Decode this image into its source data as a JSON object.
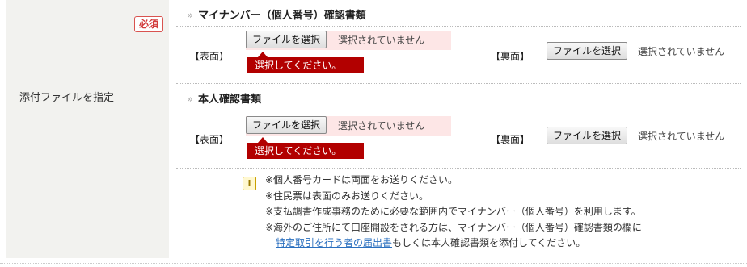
{
  "form_row": {
    "label": "添付ファイルを指定",
    "required_badge": "必須"
  },
  "sections": [
    {
      "title": "マイナンバー（個人番号）確認書類",
      "front_label": "【表面】",
      "back_label": "【裏面】",
      "front_button": "ファイルを選択",
      "front_status": "選択されていません",
      "front_error": "選択してください。",
      "back_button": "ファイルを選択",
      "back_status": "選択されていません"
    },
    {
      "title": "本人確認書類",
      "front_label": "【表面】",
      "back_label": "【裏面】",
      "front_button": "ファイルを選択",
      "front_status": "選択されていません",
      "front_error": "選択してください。",
      "back_button": "ファイルを選択",
      "back_status": "選択されていません"
    }
  ],
  "notes": {
    "icon": "info-icon",
    "lines": [
      "※個人番号カードは両面をお送りください。",
      "※住民票は表面のみお送りください。",
      "※支払調書作成事務のために必要な範囲内でマイナンバー（個人番号）を利用します。",
      "※海外のご住所にて口座開設をされる方は、マイナンバー（個人番号）確認書類の欄に"
    ],
    "link_text": "特定取引を行う者の届出書",
    "after_link": "もしくは本人確認書類を添付してください。"
  },
  "colors": {
    "error_bg": "#b20000",
    "error_field_bg": "#fde6e6",
    "badge_red": "#d23c3c",
    "link": "#2a6fbf"
  }
}
